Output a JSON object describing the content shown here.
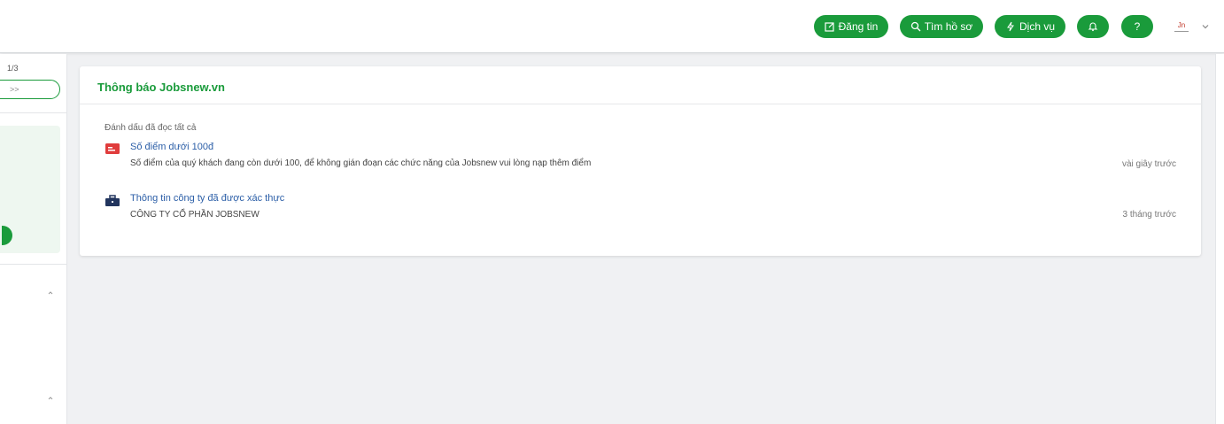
{
  "header": {
    "buttons": [
      {
        "label": "Đăng tin",
        "icon": "edit-icon"
      },
      {
        "label": "Tìm hồ sơ",
        "icon": "search-icon"
      },
      {
        "label": "Dịch vụ",
        "icon": "lightning-icon"
      }
    ],
    "bell_icon": "bell-icon",
    "help_label": "?",
    "avatar_initials": "Jn",
    "accent_color": "#1a9b3b"
  },
  "sidebar": {
    "pager_text": "1/3",
    "next_label": ">>"
  },
  "notifications": {
    "title": "Thông báo Jobsnew.vn",
    "mark_all_read": "Đánh dấu đã đọc tất cả",
    "items": [
      {
        "icon": "card-icon",
        "title": "Số điểm dưới 100đ",
        "body": "Số điểm của quý khách đang còn dưới 100, để không gián đoạn các chức năng của Jobsnew vui lòng nạp thêm điểm",
        "time": "vài giây trước"
      },
      {
        "icon": "briefcase-icon",
        "title": "Thông tin công ty đã được xác thực",
        "body": "CÔNG TY CỔ PHẦN JOBSNEW",
        "time": "3 tháng trước"
      }
    ]
  }
}
